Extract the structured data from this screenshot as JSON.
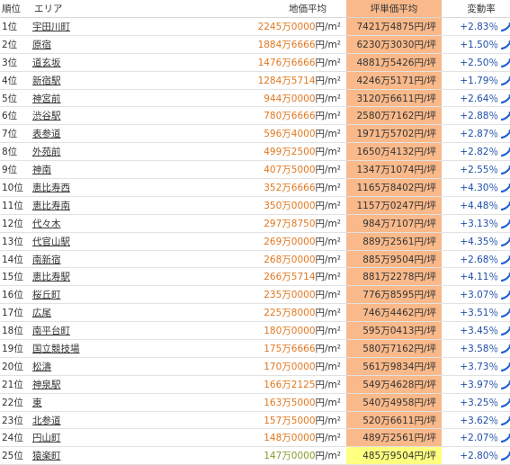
{
  "headers": {
    "rank": "順位",
    "area": "エリア",
    "avg": "地価平均",
    "tsubo": "坪単価平均",
    "rate": "変動率"
  },
  "rows": [
    {
      "rank": "1位",
      "area": "宇田川町",
      "avg": "2245万0000",
      "tsubo": "7421万4875",
      "rate": "+2.83％"
    },
    {
      "rank": "2位",
      "area": "原宿",
      "avg": "1884万6666",
      "tsubo": "6230万3030",
      "rate": "+1.50％"
    },
    {
      "rank": "3位",
      "area": "道玄坂",
      "avg": "1476万6666",
      "tsubo": "4881万5426",
      "rate": "+2.50％"
    },
    {
      "rank": "4位",
      "area": "新宿駅",
      "avg": "1284万5714",
      "tsubo": "4246万5171",
      "rate": "+1.79％"
    },
    {
      "rank": "5位",
      "area": "神宮前",
      "avg": "944万0000",
      "tsubo": "3120万6611",
      "rate": "+2.64％"
    },
    {
      "rank": "6位",
      "area": "渋谷駅",
      "avg": "780万6666",
      "tsubo": "2580万7162",
      "rate": "+2.88％"
    },
    {
      "rank": "7位",
      "area": "表参道",
      "avg": "596万4000",
      "tsubo": "1971万5702",
      "rate": "+2.87％"
    },
    {
      "rank": "8位",
      "area": "外苑前",
      "avg": "499万2500",
      "tsubo": "1650万4132",
      "rate": "+2.82％"
    },
    {
      "rank": "9位",
      "area": "神南",
      "avg": "407万5000",
      "tsubo": "1347万1074",
      "rate": "+2.55％"
    },
    {
      "rank": "10位",
      "area": "恵比寿西",
      "avg": "352万6666",
      "tsubo": "1165万8402",
      "rate": "+4.30％"
    },
    {
      "rank": "11位",
      "area": "恵比寿南",
      "avg": "350万0000",
      "tsubo": "1157万0247",
      "rate": "+4.48％"
    },
    {
      "rank": "12位",
      "area": "代々木",
      "avg": "297万8750",
      "tsubo": "984万7107",
      "rate": "+3.13％"
    },
    {
      "rank": "13位",
      "area": "代官山駅",
      "avg": "269万0000",
      "tsubo": "889万2561",
      "rate": "+4.35％"
    },
    {
      "rank": "14位",
      "area": "南新宿",
      "avg": "268万0000",
      "tsubo": "885万9504",
      "rate": "+2.68％"
    },
    {
      "rank": "15位",
      "area": "恵比寿駅",
      "avg": "266万5714",
      "tsubo": "881万2278",
      "rate": "+4.11％"
    },
    {
      "rank": "16位",
      "area": "桜丘町",
      "avg": "235万0000",
      "tsubo": "776万8595",
      "rate": "+3.07％"
    },
    {
      "rank": "17位",
      "area": "広尾",
      "avg": "225万8000",
      "tsubo": "746万4462",
      "rate": "+3.51％"
    },
    {
      "rank": "18位",
      "area": "南平台町",
      "avg": "180万0000",
      "tsubo": "595万0413",
      "rate": "+3.45％"
    },
    {
      "rank": "19位",
      "area": "国立競技場",
      "avg": "175万6666",
      "tsubo": "580万7162",
      "rate": "+3.58％"
    },
    {
      "rank": "20位",
      "area": "松濤",
      "avg": "170万0000",
      "tsubo": "561万9834",
      "rate": "+3.73％"
    },
    {
      "rank": "21位",
      "area": "神泉駅",
      "avg": "166万2125",
      "tsubo": "549万4628",
      "rate": "+3.97％"
    },
    {
      "rank": "22位",
      "area": "東",
      "avg": "163万5000",
      "tsubo": "540万4958",
      "rate": "+3.25％"
    },
    {
      "rank": "23位",
      "area": "北参道",
      "avg": "157万5000",
      "tsubo": "520万6611",
      "rate": "+3.62％"
    },
    {
      "rank": "24位",
      "area": "円山町",
      "avg": "148万0000",
      "tsubo": "489万2561",
      "rate": "+2.07％"
    },
    {
      "rank": "25位",
      "area": "猿楽町",
      "avg": "147万0000",
      "tsubo": "485万9504",
      "rate": "+2.80％"
    }
  ],
  "units": {
    "avg": "円/m²",
    "tsubo": "円/坪"
  },
  "icon": "rising-trend-arrow-icon",
  "colors": {
    "price": "#e07820",
    "price_last": "#8a9a2a",
    "tsubo_bg": "#f9b98a",
    "tsubo_bg_last": "#ffff80",
    "rate": "#1f4fa8",
    "icon": "#1e5fd6"
  }
}
